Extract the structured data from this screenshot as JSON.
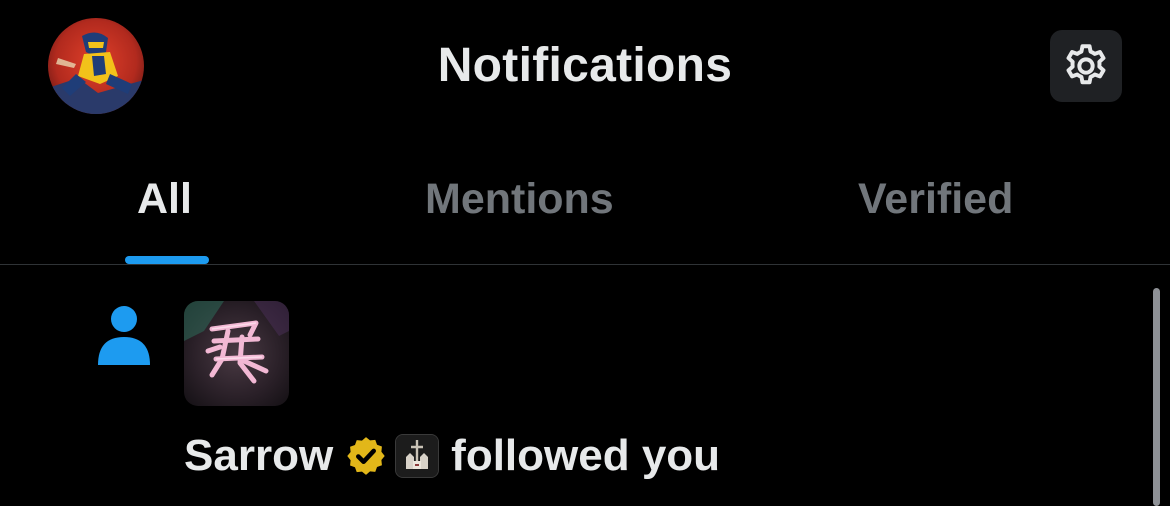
{
  "header": {
    "title": "Notifications",
    "avatar_icon": "user-avatar-superhero",
    "settings_icon": "gear-icon"
  },
  "tabs": [
    {
      "label": "All",
      "active": true
    },
    {
      "label": "Mentions",
      "active": false
    },
    {
      "label": "Verified",
      "active": false
    }
  ],
  "notifications": [
    {
      "type": "follow",
      "type_icon": "person-icon",
      "user_name": "Sarrow",
      "verified_icon": "gold-verified-badge-icon",
      "affiliate_icon": "affiliate-badge-icon",
      "action": "followed you"
    }
  ],
  "colors": {
    "background": "#000000",
    "text_primary": "#e7e9ea",
    "text_secondary": "#71767b",
    "accent": "#1d9bf0",
    "verified_gold": "#e2b719",
    "divider": "#2f3336"
  }
}
